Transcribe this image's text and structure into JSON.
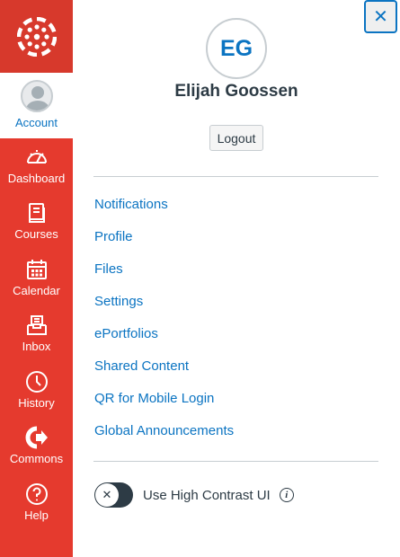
{
  "nav": {
    "account_label": "Account",
    "items": [
      {
        "label": "Dashboard",
        "icon": "dashboard-icon"
      },
      {
        "label": "Courses",
        "icon": "courses-icon"
      },
      {
        "label": "Calendar",
        "icon": "calendar-icon"
      },
      {
        "label": "Inbox",
        "icon": "inbox-icon"
      },
      {
        "label": "History",
        "icon": "history-icon"
      },
      {
        "label": "Commons",
        "icon": "commons-icon"
      },
      {
        "label": "Help",
        "icon": "help-icon"
      }
    ]
  },
  "tray": {
    "close_symbol": "✕",
    "initials": "EG",
    "user_name": "Elijah Goossen",
    "logout_label": "Logout",
    "links": [
      "Notifications",
      "Profile",
      "Files",
      "Settings",
      "ePortfolios",
      "Shared Content",
      "QR for Mobile Login",
      "Global Announcements"
    ],
    "high_contrast": {
      "label": "Use High Contrast UI",
      "enabled": false,
      "knob_symbol": "✕",
      "info_symbol": "i"
    }
  },
  "colors": {
    "nav_bg": "#e53a2e",
    "accent": "#0b74c2",
    "text": "#2d3b45"
  }
}
